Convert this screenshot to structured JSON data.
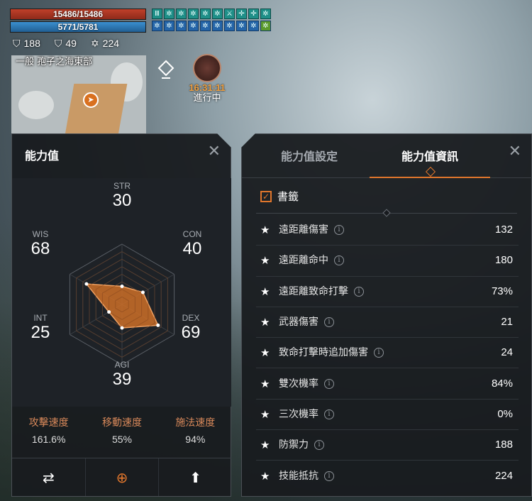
{
  "hud": {
    "hp": "15486/15486",
    "mp": "5771/5781",
    "defense": "188",
    "stat2": "49",
    "stat3": "224",
    "buffs": [
      "Ⅲ",
      "✲",
      "✲",
      "✲",
      "✲",
      "✲",
      "⚔",
      "✛",
      "✛",
      "✲",
      "✲",
      "✲",
      "✲",
      "✲",
      "✲",
      "✲",
      "✲",
      "✲",
      "✲",
      "✲"
    ]
  },
  "minimap": {
    "area_prefix": "一般",
    "area_name": "孢子之海東部"
  },
  "event": {
    "time": "16:31:11",
    "status": "進行中"
  },
  "stats_panel": {
    "title": "能力值",
    "close": "✕",
    "stats": [
      {
        "key": "STR",
        "value": 30
      },
      {
        "key": "CON",
        "value": 40
      },
      {
        "key": "DEX",
        "value": 69
      },
      {
        "key": "AGI",
        "value": 39
      },
      {
        "key": "INT",
        "value": 25
      },
      {
        "key": "WIS",
        "value": 68
      }
    ],
    "speeds": [
      {
        "name": "攻擊速度",
        "value": "161.6%"
      },
      {
        "name": "移動速度",
        "value": "55%"
      },
      {
        "name": "施法速度",
        "value": "94%"
      }
    ],
    "footer": [
      "⇄",
      "⊕",
      "⬆"
    ]
  },
  "info_panel": {
    "tabs": [
      "能力值設定",
      "能力值資訊"
    ],
    "active_tab": 1,
    "close": "✕",
    "bookmark_label": "書籤",
    "rows": [
      {
        "label": "遠距離傷害",
        "value": "132"
      },
      {
        "label": "遠距離命中",
        "value": "180"
      },
      {
        "label": "遠距離致命打擊",
        "value": "73%"
      },
      {
        "label": "武器傷害",
        "value": "21"
      },
      {
        "label": "致命打擊時追加傷害",
        "value": "24"
      },
      {
        "label": "雙次機率",
        "value": "84%"
      },
      {
        "label": "三次機率",
        "value": "0%"
      },
      {
        "label": "防禦力",
        "value": "188"
      },
      {
        "label": "技能抵抗",
        "value": "224"
      }
    ]
  },
  "colors": {
    "accent": "#e0762c",
    "hp": "#c0402a",
    "mp": "#3a8fd0"
  }
}
